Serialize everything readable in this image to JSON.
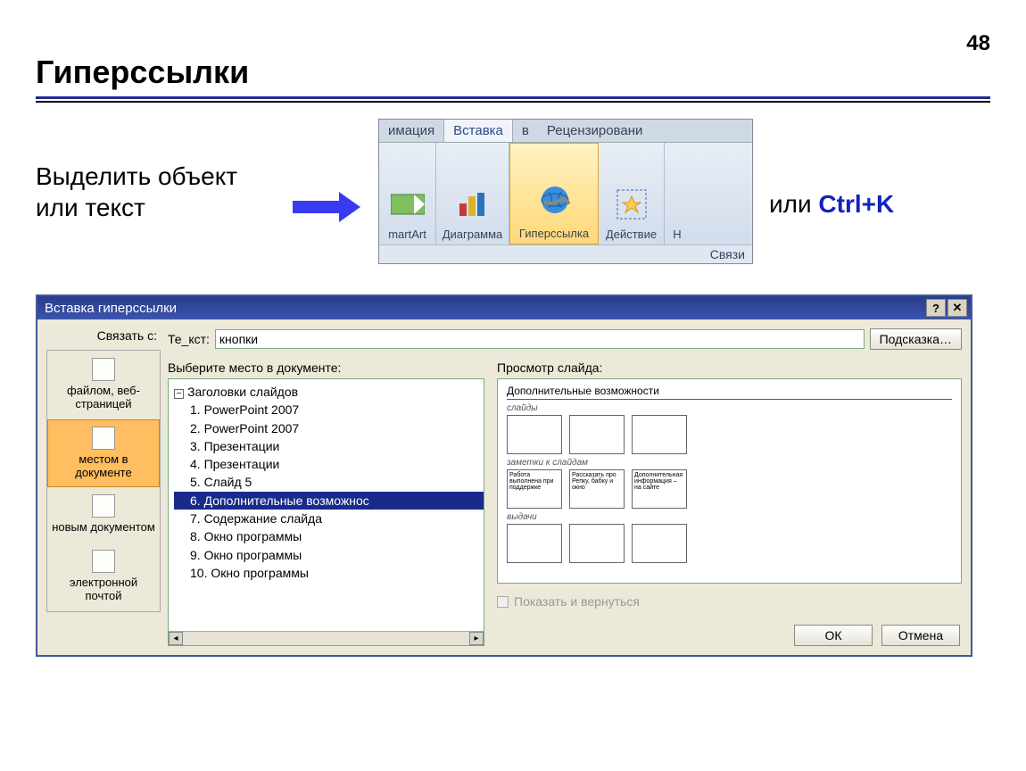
{
  "page_number": "48",
  "title": "Гиперссылки",
  "instruction": "Выделить объект или текст",
  "hotkey": {
    "prefix": "или ",
    "combo": "Ctrl+K"
  },
  "ribbon": {
    "tabs": [
      "имация",
      "Вставка",
      "в",
      "Рецензировани"
    ],
    "active_index": 1,
    "groups": [
      {
        "label": "martArt"
      },
      {
        "label": "Диаграмма"
      },
      {
        "label": "Гиперссылка"
      },
      {
        "label": "Действие"
      },
      {
        "label": "Н"
      }
    ],
    "footer": "Связи"
  },
  "dialog": {
    "title": "Вставка гиперссылки",
    "link_to_label": "Связать с:",
    "link_items": [
      "файлом, веб-страницей",
      "местом в документе",
      "новым документом",
      "электронной почтой"
    ],
    "active_link_index": 1,
    "text_label": "Те_кст:",
    "text_value": "кнопки",
    "hint_button": "Подсказка…",
    "tree_label": "Выберите место в документе:",
    "tree": {
      "root": "Заголовки слайдов",
      "items": [
        "1. PowerPoint 2007",
        "2. PowerPoint 2007",
        "3. Презентации",
        "4. Презентации",
        "5. Слайд 5",
        "6. Дополнительные возможнос",
        "7. Содержание слайда",
        "8. Окно программы",
        "9. Окно программы",
        "10. Окно программы"
      ],
      "selected_index": 5
    },
    "preview_label": "Просмотр слайда:",
    "preview": {
      "heading": "Дополнительные возможности",
      "section1": "слайды",
      "section2": "заметки к слайдам",
      "section3": "выдачи",
      "note1": "Работа выполнена при поддержке",
      "note2": "Рассказать про Репку, бабку и окно",
      "note3": "Дополнительная информация – на сайте"
    },
    "show_return_label": "Показать и вернуться",
    "ok": "ОК",
    "cancel": "Отмена"
  }
}
